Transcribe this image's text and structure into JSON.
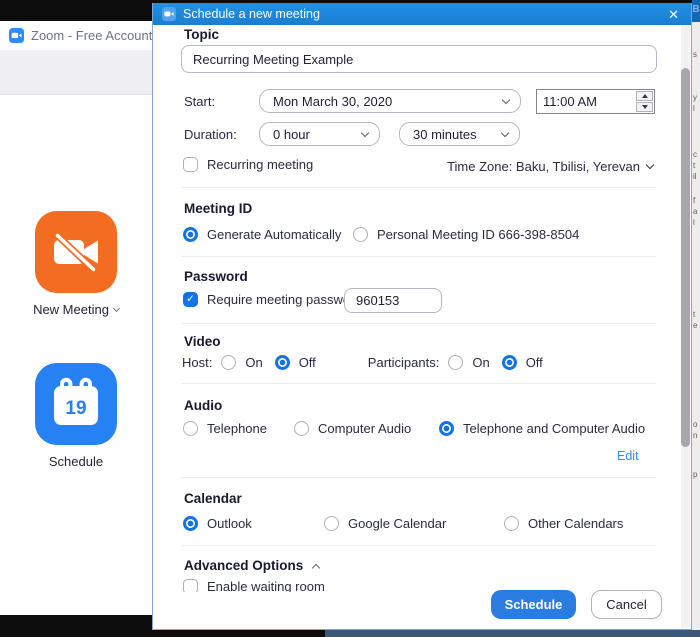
{
  "icons": {
    "check": "✓",
    "close": "✕"
  },
  "background_window": {
    "title": "Zoom - Free Account",
    "new_meeting": {
      "label": "New Meeting",
      "color": "#F26D21"
    },
    "schedule": {
      "label": "Schedule",
      "day": "19",
      "color": "#2681F2"
    }
  },
  "dialog": {
    "title": "Schedule a new meeting",
    "topic": {
      "label": "Topic",
      "value": "Recurring Meeting Example"
    },
    "start": {
      "label": "Start:",
      "date": "Mon  March 30, 2020",
      "time": "11:00 AM"
    },
    "duration": {
      "label": "Duration:",
      "hours": "0 hour",
      "minutes": "30 minutes"
    },
    "recurring": {
      "label": "Recurring meeting",
      "checked": false
    },
    "timezone": {
      "label": "Time Zone: Baku, Tbilisi, Yerevan"
    },
    "meeting_id": {
      "heading": "Meeting ID",
      "options": [
        {
          "label": "Generate Automatically",
          "selected": true
        },
        {
          "label": "Personal Meeting ID 666-398-8504",
          "selected": false
        }
      ]
    },
    "password": {
      "heading": "Password",
      "checkbox_label": "Require meeting password",
      "checked": true,
      "value": "960153"
    },
    "video": {
      "heading": "Video",
      "host_label": "Host:",
      "participants_label": "Participants:",
      "on_label": "On",
      "off_label": "Off",
      "host_selected": "Off",
      "participants_selected": "Off"
    },
    "audio": {
      "heading": "Audio",
      "options": [
        {
          "label": "Telephone",
          "selected": false
        },
        {
          "label": "Computer Audio",
          "selected": false
        },
        {
          "label": "Telephone and Computer Audio",
          "selected": true
        }
      ],
      "edit_label": "Edit"
    },
    "calendar": {
      "heading": "Calendar",
      "options": [
        {
          "label": "Outlook",
          "selected": true
        },
        {
          "label": "Google Calendar",
          "selected": false
        },
        {
          "label": "Other Calendars",
          "selected": false
        }
      ]
    },
    "advanced": {
      "heading": "Advanced Options",
      "waiting_room_label": "Enable waiting room"
    },
    "footer": {
      "schedule_label": "Schedule",
      "cancel_label": "Cancel"
    }
  },
  "colors": {
    "titlebar_blue": "#1d86da",
    "accent_blue": "#1173e8",
    "link_blue": "#2d8cff",
    "new_meeting_orange": "#F26D21",
    "schedule_blue": "#2681F2"
  }
}
